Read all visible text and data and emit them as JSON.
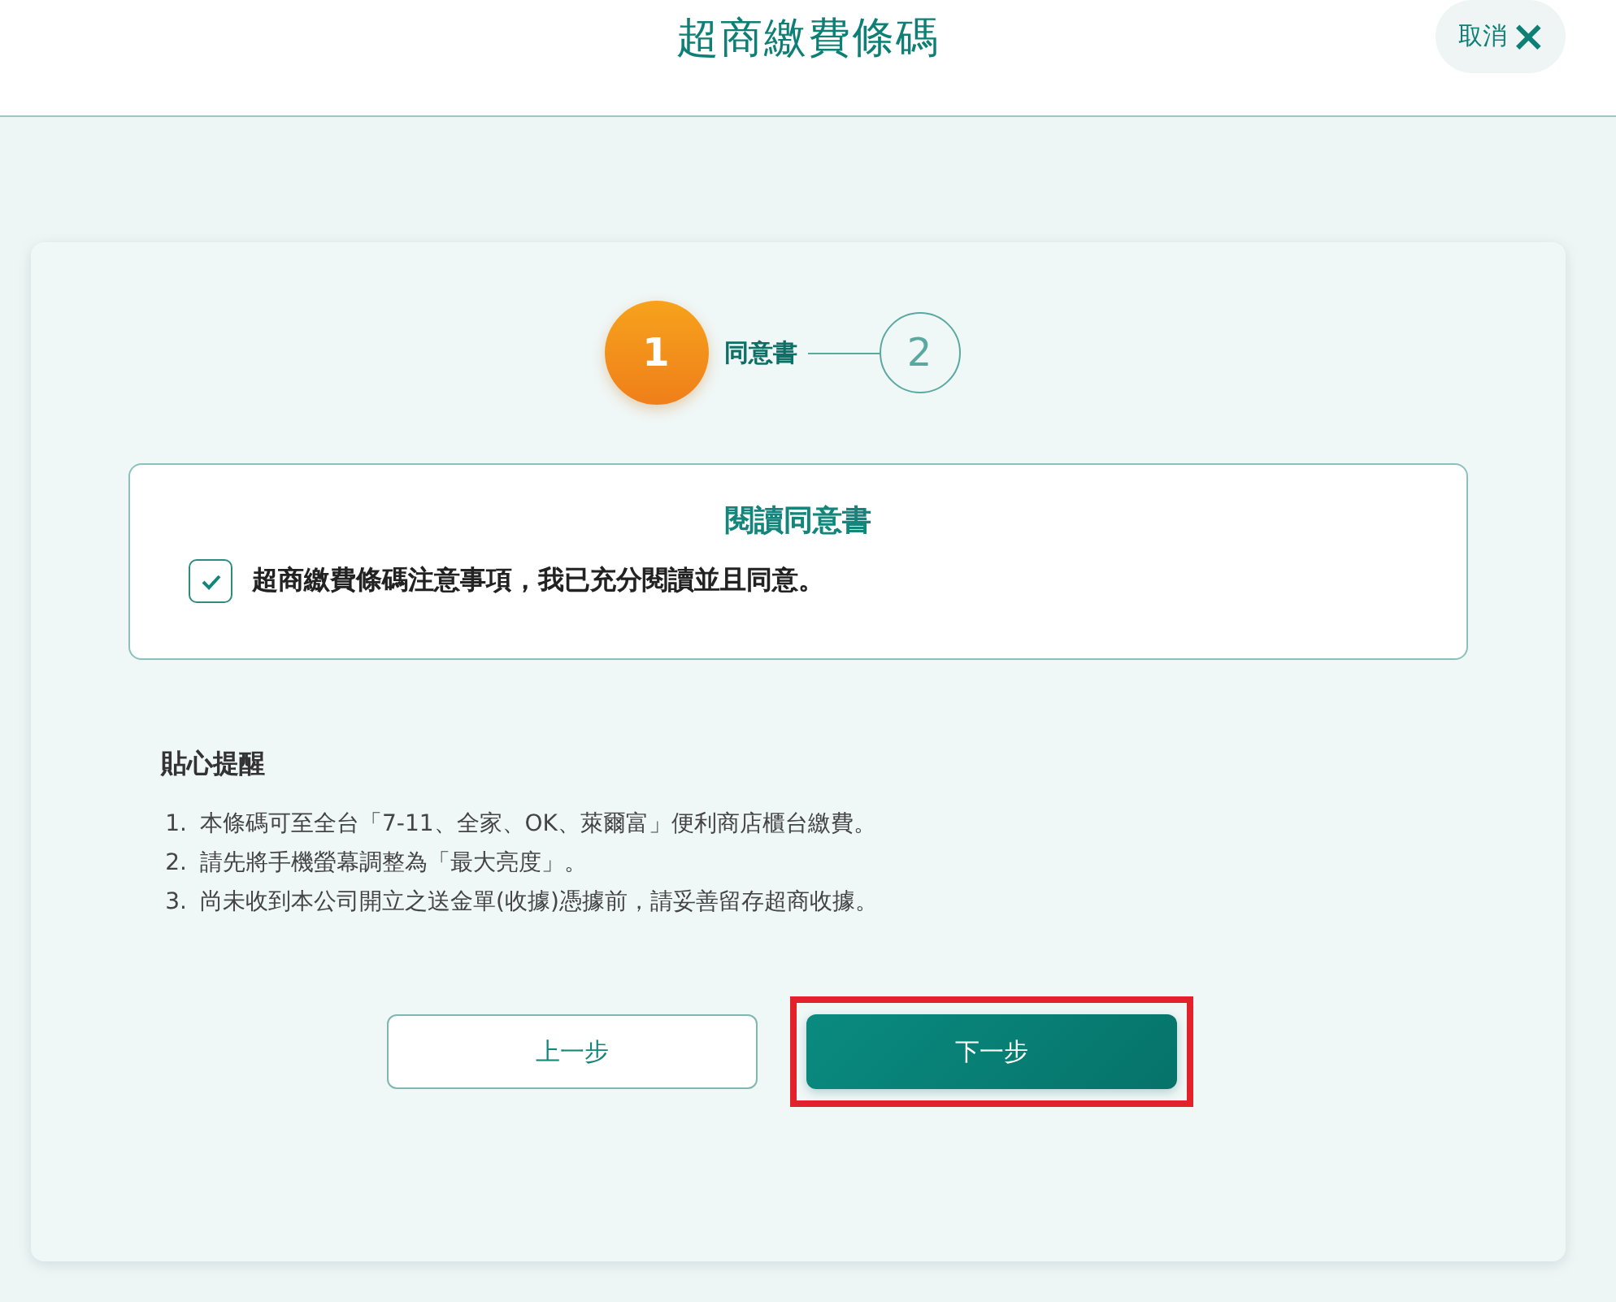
{
  "header": {
    "title": "超商繳費條碼",
    "cancel_button": {
      "label": "取消",
      "icon": "×"
    }
  },
  "steps": [
    {
      "number": "1",
      "label": "同意書",
      "selected": true
    },
    {
      "number": "2",
      "selected": false
    }
  ],
  "consent": {
    "title": "閱讀同意書",
    "checked": true,
    "text": "超商繳費條碼注意事項，我已充分閱讀並且同意。"
  },
  "reminder": {
    "title": "貼心提醒",
    "items": [
      {
        "number": "1.",
        "text": "本條碼可至全台「7-11、全家、OK、萊爾富」便利商店櫃台繳費。"
      },
      {
        "number": "2.",
        "text": "請先將手機螢幕調整為「最大亮度」。"
      },
      {
        "number": "3.",
        "text": "尚未收到本公司開立之送金單(收據)憑據前，請妥善留存超商收據。"
      }
    ]
  },
  "buttons": [
    {
      "label": "上一步",
      "kind": "secondary",
      "highlighted": false
    },
    {
      "label": "下一步",
      "kind": "primary",
      "highlighted": true
    }
  ]
}
